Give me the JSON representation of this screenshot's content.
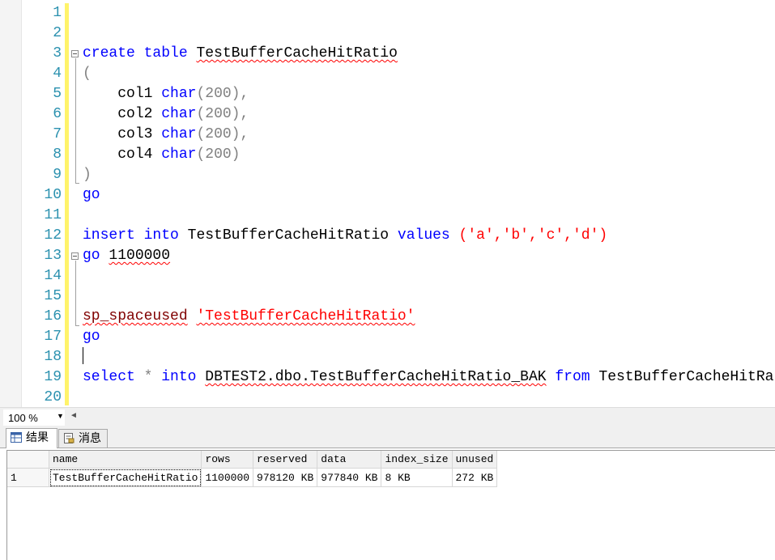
{
  "editor": {
    "line_numbers": [
      "1",
      "2",
      "3",
      "4",
      "5",
      "6",
      "7",
      "8",
      "9",
      "10",
      "11",
      "12",
      "13",
      "14",
      "15",
      "16",
      "17",
      "18",
      "19",
      "20"
    ],
    "lines": {
      "l3": {
        "kw1": "create",
        "kw2": "table",
        "name": "TestBufferCacheHitRatio"
      },
      "l4": {
        "paren": "("
      },
      "l5": {
        "col": "col1",
        "type": "char",
        "size": "(200),",
        "pad": "    "
      },
      "l6": {
        "col": "col2",
        "type": "char",
        "size": "(200),",
        "pad": "    "
      },
      "l7": {
        "col": "col3",
        "type": "char",
        "size": "(200),",
        "pad": "    "
      },
      "l8": {
        "col": "col4",
        "type": "char",
        "size": "(200)",
        "pad": "    "
      },
      "l9": {
        "paren": ")"
      },
      "l10": {
        "kw": "go"
      },
      "l12": {
        "kw1": "insert",
        "kw2": "into",
        "name": "TestBufferCacheHitRatio",
        "kw3": "values",
        "vals": "('a','b','c','d')"
      },
      "l13": {
        "kw": "go",
        "count": "1100000"
      },
      "l16": {
        "proc": "sp_spaceused",
        "arg": "'TestBufferCacheHitRatio'"
      },
      "l17": {
        "kw": "go"
      },
      "l19": {
        "kw1": "select",
        "star": "*",
        "kw2": "into",
        "target": "DBTEST2.dbo.TestBufferCacheHitRatio_BAK",
        "kw3": "from",
        "source": "TestBufferCacheHitRatio"
      }
    }
  },
  "zoom": {
    "value": "100 %"
  },
  "results": {
    "tabs": [
      {
        "label": "结果"
      },
      {
        "label": "消息"
      }
    ],
    "columns": [
      "name",
      "rows",
      "reserved",
      "data",
      "index_size",
      "unused"
    ],
    "rows": [
      {
        "num": "1",
        "cells": [
          "TestBufferCacheHitRatio",
          "1100000",
          "978120 KB",
          "977840 KB",
          "8 KB",
          "272 KB"
        ]
      }
    ]
  }
}
